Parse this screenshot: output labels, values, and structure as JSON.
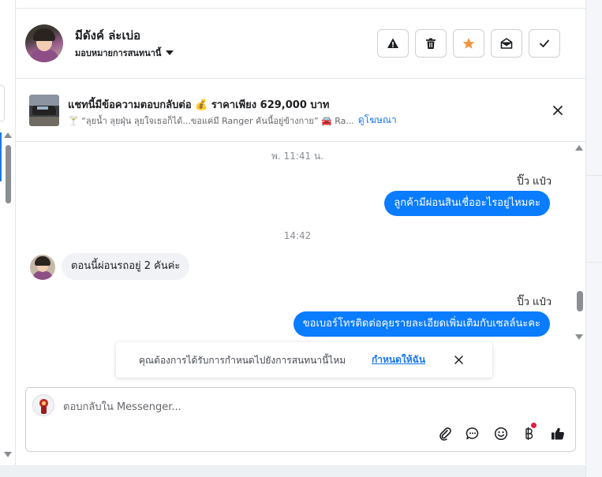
{
  "header": {
    "contact_name": "มีดังค์ ล่ะเบ่อ",
    "assign_label": "มอบหมายการสนทนานี้",
    "actions": [
      "report-icon",
      "trash-icon",
      "star-icon",
      "envelope-open-icon",
      "check-icon"
    ],
    "star_color": "#f7923b"
  },
  "ad": {
    "title": "แชทนี้มีข้อความตอบกลับต่อ 💰 ราคาเพียง 629,000 บาท",
    "quote": "🍸 “ลุยน้ำ ลุยฝุ่น ลุยใจเธอก็ได้...ขอแค่มี Ranger คันนี้อยู่ข้างกาย” 🚘 Ra...",
    "link": "ดูโฆษณา"
  },
  "thread": {
    "timestamp_1": "พ. 11:41 น.",
    "sender_1": "ปิ๊ว แป๋ว",
    "message_out_1": "ลูกค้ามีผ่อนสินเชื่ออะไรอยู่ไหมคะ",
    "timestamp_2": "14:42",
    "message_in_1": "ตอนนี้ผ่อนรถอยู่ 2 คันค่ะ",
    "sender_2": "ปิ๊ว แป๋ว",
    "message_out_2": "ขอเบอร์โทรติดต่อคุยรายละเอียดเพิ่มเติมกับเซลล์นะคะ",
    "outgoing_color": "#0a7cff"
  },
  "toast": {
    "text": "คุณต้องการได้รับการกำหนดไปยังการสนทนานี้ไหม",
    "link": "กำหนดให้ฉัน"
  },
  "composer": {
    "placeholder": "ตอบกลับใน Messenger...",
    "tools": [
      "attachment-icon",
      "saved-replies-icon",
      "emoji-icon",
      "baht-icon",
      "thumbs-up-icon"
    ]
  }
}
